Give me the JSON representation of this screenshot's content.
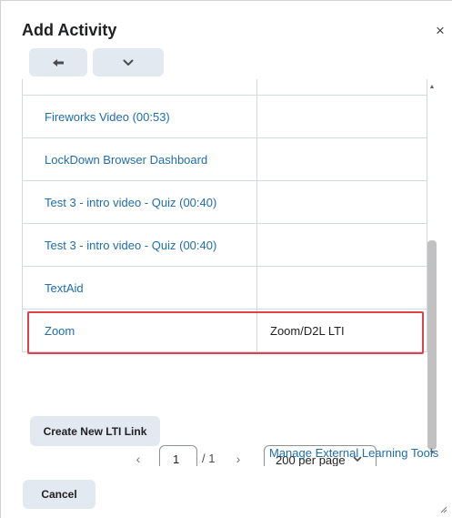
{
  "dialog": {
    "title": "Add Activity",
    "close_icon": "×"
  },
  "toolbar": {
    "back_icon": "back-arrow-icon",
    "menu_icon": "chevron-down-icon"
  },
  "table": {
    "rows": [
      {
        "name": "",
        "type": ""
      },
      {
        "name": "Fireworks Video (00:53)",
        "type": ""
      },
      {
        "name": "LockDown Browser Dashboard",
        "type": ""
      },
      {
        "name": "Test 3 - intro video - Quiz (00:40)",
        "type": ""
      },
      {
        "name": "Test 3 - intro video - Quiz (00:40)",
        "type": ""
      },
      {
        "name": "TextAid",
        "type": ""
      },
      {
        "name": "Zoom",
        "type": "Zoom/D2L LTI"
      }
    ]
  },
  "pager": {
    "page_value": "1",
    "total": "/ 1",
    "per_page": "200 per page"
  },
  "actions": {
    "create_label": "Create New LTI Link",
    "manage_label": "Manage External Learning Tools",
    "cancel_label": "Cancel"
  },
  "colors": {
    "link": "#1f6dab",
    "button_bg": "#e3e9f1",
    "highlight": "#e0424a"
  }
}
